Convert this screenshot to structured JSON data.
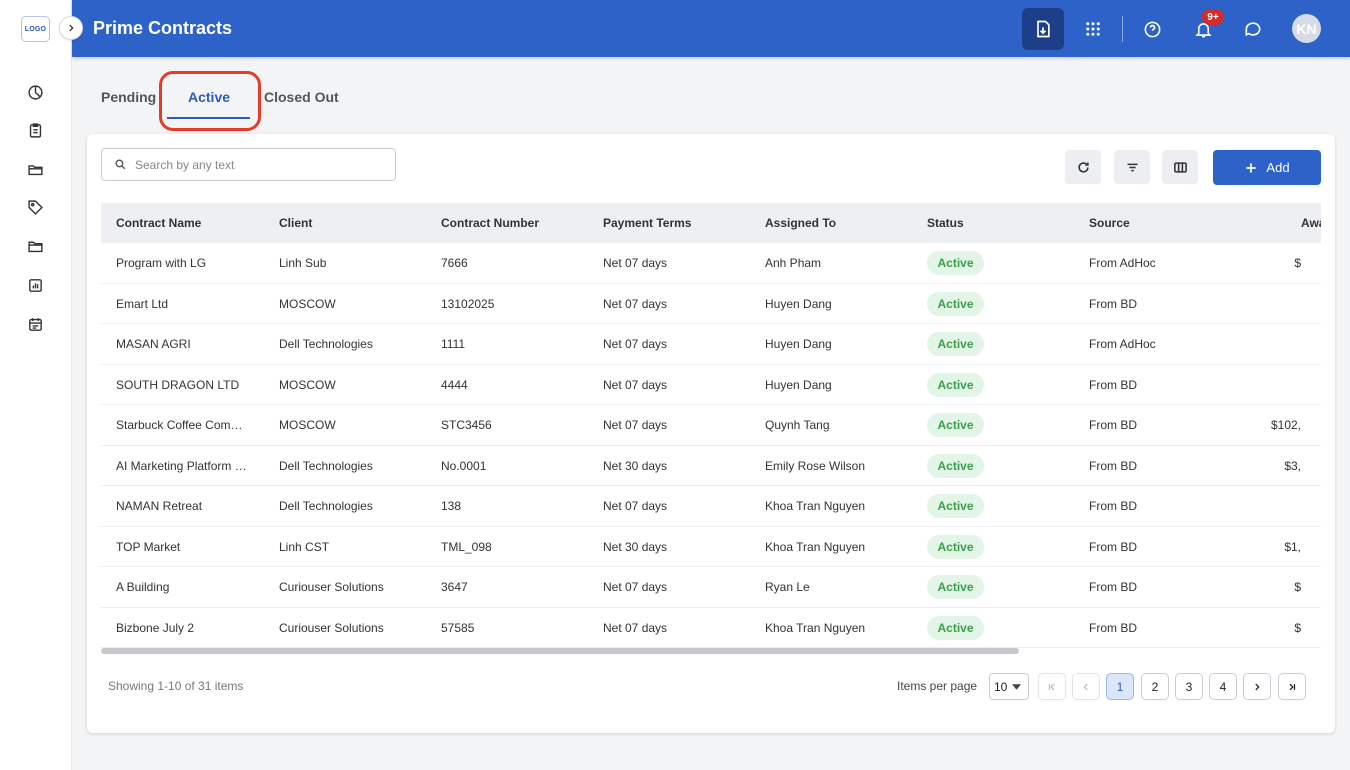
{
  "sidebar": {
    "logo_text": "LOGO",
    "items": [
      {
        "name": "dashboard",
        "icon": "pie-chart-icon"
      },
      {
        "name": "contracts",
        "icon": "clipboard-icon"
      },
      {
        "name": "folder",
        "icon": "folder-open-icon"
      },
      {
        "name": "tags",
        "icon": "tag-icon"
      },
      {
        "name": "documents",
        "icon": "folder-icon"
      },
      {
        "name": "reports",
        "icon": "bar-chart-icon"
      },
      {
        "name": "calendar",
        "icon": "calendar-icon"
      }
    ]
  },
  "header": {
    "title": "Prime Contracts",
    "notification_badge": "9+",
    "avatar_initials": "KN",
    "icons": [
      "download-doc-icon",
      "apps-grid-icon",
      "help-icon",
      "bell-icon",
      "chat-icon"
    ]
  },
  "tabs": [
    {
      "label": "Pending",
      "active": false
    },
    {
      "label": "Active",
      "active": true
    },
    {
      "label": "Closed Out",
      "active": false
    }
  ],
  "toolbar": {
    "search_placeholder": "Search by any text",
    "add_label": "Add"
  },
  "table": {
    "columns": [
      "Contract Name",
      "Client",
      "Contract Number",
      "Payment Terms",
      "Assigned To",
      "Status",
      "Source",
      "Awa"
    ],
    "rows": [
      {
        "name": "Program with LG",
        "client": "Linh Sub",
        "number": "7666",
        "terms": "Net 07 days",
        "assigned": "Anh Pham",
        "status": "Active",
        "source": "From AdHoc",
        "award": "$"
      },
      {
        "name": "Emart Ltd",
        "client": "MOSCOW",
        "number": "13102025",
        "terms": "Net 07 days",
        "assigned": "Huyen Dang",
        "status": "Active",
        "source": "From BD",
        "award": ""
      },
      {
        "name": "MASAN AGRI",
        "client": "Dell Technologies",
        "number": "1111",
        "terms": "Net 07 days",
        "assigned": "Huyen Dang",
        "status": "Active",
        "source": "From AdHoc",
        "award": ""
      },
      {
        "name": "SOUTH DRAGON LTD",
        "client": "MOSCOW",
        "number": "4444",
        "terms": "Net 07 days",
        "assigned": "Huyen Dang",
        "status": "Active",
        "source": "From BD",
        "award": ""
      },
      {
        "name": "Starbuck Coffee Com…",
        "client": "MOSCOW",
        "number": "STC3456",
        "terms": "Net 07 days",
        "assigned": "Quynh Tang",
        "status": "Active",
        "source": "From BD",
        "award": "$102,"
      },
      {
        "name": "AI Marketing Platform …",
        "client": "Dell Technologies",
        "number": "No.0001",
        "terms": "Net 30 days",
        "assigned": "Emily Rose Wilson",
        "status": "Active",
        "source": "From BD",
        "award": "$3,"
      },
      {
        "name": "NAMAN Retreat",
        "client": "Dell Technologies",
        "number": "138",
        "terms": "Net 07 days",
        "assigned": "Khoa Tran Nguyen",
        "status": "Active",
        "source": "From BD",
        "award": ""
      },
      {
        "name": "TOP Market",
        "client": "Linh CST",
        "number": "TML_098",
        "terms": "Net 30 days",
        "assigned": "Khoa Tran Nguyen",
        "status": "Active",
        "source": "From BD",
        "award": "$1,"
      },
      {
        "name": "A Building",
        "client": "Curiouser Solutions",
        "number": "3647",
        "terms": "Net 07 days",
        "assigned": "Ryan Le",
        "status": "Active",
        "source": "From BD",
        "award": "$"
      },
      {
        "name": "Bizbone July 2",
        "client": "Curiouser Solutions",
        "number": "57585",
        "terms": "Net 07 days",
        "assigned": "Khoa Tran Nguyen",
        "status": "Active",
        "source": "From BD",
        "award": "$"
      }
    ]
  },
  "pagination": {
    "showing": "Showing 1-10 of 31 items",
    "items_per_page_label": "Items per page",
    "items_per_page": "10",
    "pages": [
      "1",
      "2",
      "3",
      "4"
    ],
    "current_page": "1"
  },
  "colors": {
    "primary": "#2d62c9",
    "active_badge_bg": "#e3f5e6",
    "active_badge_text": "#3aa04d",
    "highlight": "#e53b2b"
  }
}
